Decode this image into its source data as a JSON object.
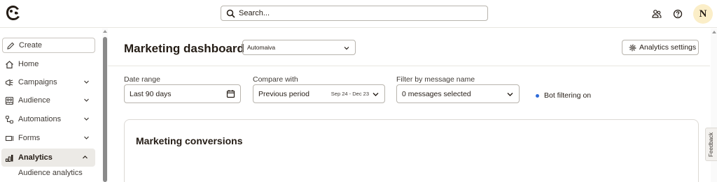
{
  "topbar": {
    "search_placeholder": "Search...",
    "avatar_initial": "N",
    "icons": [
      "mailchimp-logo-icon",
      "search-icon",
      "people-icon",
      "help-icon"
    ]
  },
  "sidebar": {
    "create_label": "Create",
    "items": [
      {
        "label": "Home",
        "icon": "home-icon",
        "chevron": "none"
      },
      {
        "label": "Campaigns",
        "icon": "megaphone-icon",
        "chevron": "down"
      },
      {
        "label": "Audience",
        "icon": "audience-icon",
        "chevron": "down"
      },
      {
        "label": "Automations",
        "icon": "automations-icon",
        "chevron": "down"
      },
      {
        "label": "Forms",
        "icon": "forms-icon",
        "chevron": "down"
      },
      {
        "label": "Analytics",
        "icon": "analytics-icon",
        "chevron": "up",
        "active": true
      }
    ],
    "sub_items": [
      "Audience analytics"
    ]
  },
  "main": {
    "title": "Marketing dashboard",
    "brand_select_value": "Automaiva",
    "settings_label": "Analytics settings",
    "filters": {
      "date_range": {
        "label": "Date range",
        "value": "Last 90 days"
      },
      "compare_with": {
        "label": "Compare with",
        "value": "Previous period",
        "range": "Sep 24 - Dec 23"
      },
      "message_name": {
        "label": "Filter by message name",
        "value": "0 messages selected"
      }
    },
    "bot_filtering": "Bot filtering on",
    "card_title": "Marketing conversions",
    "feedback_label": "Feedback"
  },
  "colors": {
    "text": "#241c15",
    "accent_dot": "#2e6bd9",
    "active_bg": "#eceae6",
    "avatar_bg": "#fbeec8"
  }
}
